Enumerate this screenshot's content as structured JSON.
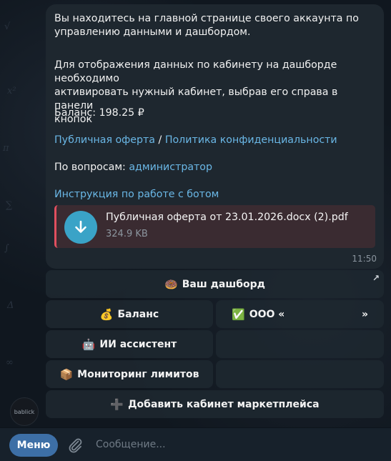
{
  "message": {
    "line1": "Вы находитесь на главной странице своего аккаунта по",
    "line2": "управлению данными и дашбордом.",
    "line3": "Для отображения данных по кабинету на дашборде необходимо",
    "line4": "активировать нужный кабинет, выбрав его справа в панели",
    "line5": "кнопок",
    "balance_label": "Баланс:",
    "balance_value": "198.25 ₽",
    "offer_link": "Публичная оферта",
    "separator": "/",
    "privacy_link": "Политика конфиденциальности",
    "questions_label": "По вопросам:",
    "admin_link": "администратор",
    "instruction_link": "Инструкция по работе с ботом",
    "file": {
      "name": "Публичная оферта от 23.01.2026.docx (2).pdf",
      "size": "324.9 KB",
      "icon": "download-icon"
    },
    "time": "11:50"
  },
  "keyboard": {
    "dashboard": {
      "emoji": "🍩",
      "label": "Ваш дашборд"
    },
    "balance": {
      "emoji": "💰",
      "label": "Баланс"
    },
    "company": {
      "emoji": "✅",
      "label": "ООО «",
      "suffix": "»"
    },
    "ai": {
      "emoji": "🤖",
      "label": "ИИ ассистент"
    },
    "limits": {
      "emoji": "📦",
      "label": "Мониторинг лимитов"
    },
    "add": {
      "emoji": "➕",
      "label": "Добавить кабинет маркетплейса"
    }
  },
  "input_bar": {
    "menu_label": "Меню",
    "placeholder": "Сообщение...",
    "attach_icon": "paperclip-icon"
  },
  "watermark": {
    "brand": "bablick"
  },
  "colors": {
    "link": "#6ab7e6",
    "menu_button": "#3d6fa6",
    "file_icon": "#3aa3c7",
    "file_accent": "#e04f5f"
  }
}
